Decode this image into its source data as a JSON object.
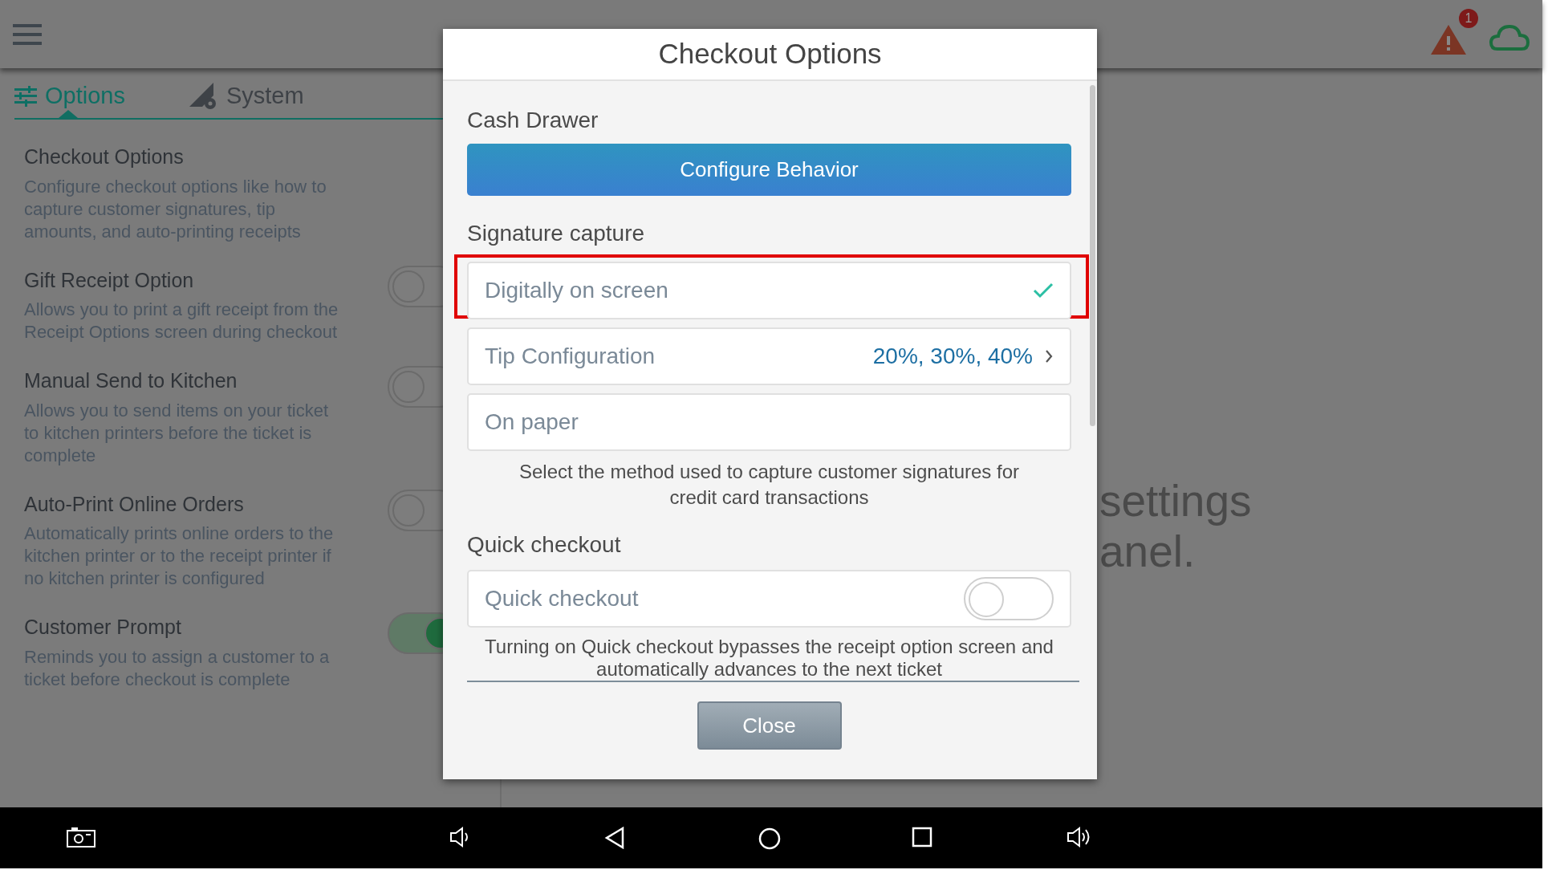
{
  "top_bar": {
    "alert_count": "1"
  },
  "tabs": [
    {
      "label": "Options",
      "kind": "options",
      "selected": true
    },
    {
      "label": "System",
      "kind": "system",
      "selected": false
    }
  ],
  "settings": [
    {
      "title": "Checkout Options",
      "description": "Configure checkout options like how to capture customer signatures, tip amounts, and auto-printing receipts",
      "kind": "page"
    },
    {
      "title": "Gift Receipt Option",
      "description": "Allows you to print a gift receipt from the Receipt Options screen during checkout",
      "kind": "toggle",
      "on": false
    },
    {
      "title": "Manual Send to Kitchen",
      "description": "Allows you to send items on your ticket to kitchen printers before the ticket is complete",
      "kind": "toggle",
      "on": false
    },
    {
      "title": "Auto-Print Online Orders",
      "description": "Automatically prints online orders to the kitchen printer or to the receipt printer if no kitchen printer is configured",
      "kind": "toggle",
      "on": false
    },
    {
      "title": "Customer Prompt",
      "description": "Reminds you to assign a customer to a ticket before checkout is complete",
      "kind": "toggle",
      "on": true
    }
  ],
  "right_pane": {
    "message_lines": [
      "settings",
      "anel."
    ]
  },
  "dialog": {
    "title": "Checkout Options",
    "cash_drawer": {
      "label": "Cash Drawer",
      "button": "Configure Behavior"
    },
    "signature_capture": {
      "label": "Signature capture",
      "options": [
        {
          "label": "Digitally on screen",
          "kind": "choice",
          "selected": true,
          "highlighted": true
        },
        {
          "label": "Tip Configuration",
          "kind": "link",
          "value": "20%, 30%, 40%",
          "selected": false,
          "highlighted": false
        },
        {
          "label": "On paper",
          "kind": "choice",
          "selected": false,
          "highlighted": false
        }
      ],
      "help": "Select the method used to capture customer signatures for credit card transactions"
    },
    "quick_checkout": {
      "label": "Quick checkout",
      "row_label": "Quick checkout",
      "on": false,
      "help": "Turning on Quick checkout bypasses the receipt option screen and automatically advances to the next ticket"
    },
    "close_button": "Close"
  }
}
